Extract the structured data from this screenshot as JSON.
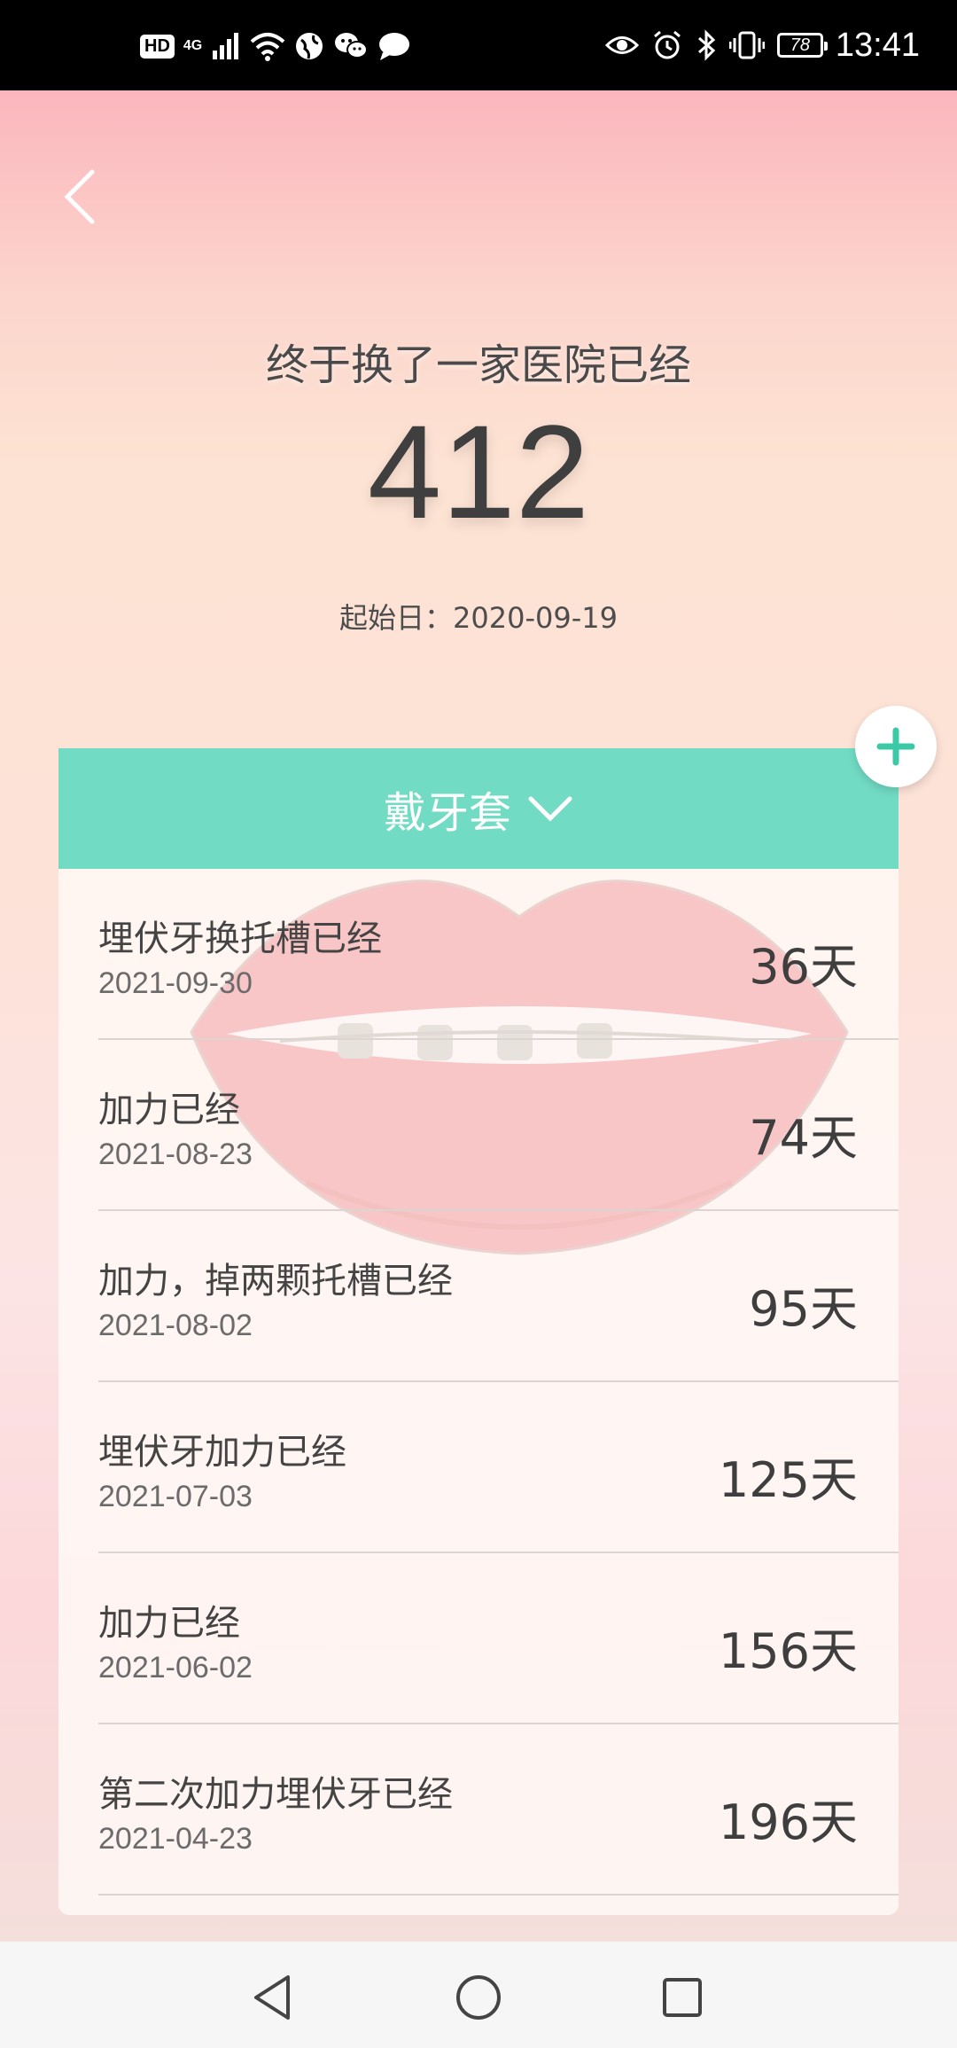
{
  "status_bar": {
    "hd": "HD",
    "network": "4G",
    "battery": "78",
    "time": "13:41"
  },
  "hero": {
    "subtitle": "终于换了一家医院已经",
    "count": "412",
    "start_date": "起始日：2020-09-19"
  },
  "category": {
    "label": "戴牙套",
    "accent_color": "#72dbc4"
  },
  "events": [
    {
      "title": "埋伏牙换托槽已经",
      "date": "2021-09-30",
      "count": "36天"
    },
    {
      "title": "加力已经",
      "date": "2021-08-23",
      "count": "74天"
    },
    {
      "title": "加力，掉两颗托槽已经",
      "date": "2021-08-02",
      "count": "95天"
    },
    {
      "title": "埋伏牙加力已经",
      "date": "2021-07-03",
      "count": "125天"
    },
    {
      "title": "加力已经",
      "date": "2021-06-02",
      "count": "156天"
    },
    {
      "title": "第二次加力埋伏牙已经",
      "date": "2021-04-23",
      "count": "196天"
    }
  ],
  "icons": {
    "back": "chevron-left-icon",
    "add": "plus-icon",
    "dropdown": "chevron-down-icon",
    "nav_back": "triangle-back-icon",
    "nav_home": "circle-home-icon",
    "nav_recent": "square-recent-icon"
  }
}
